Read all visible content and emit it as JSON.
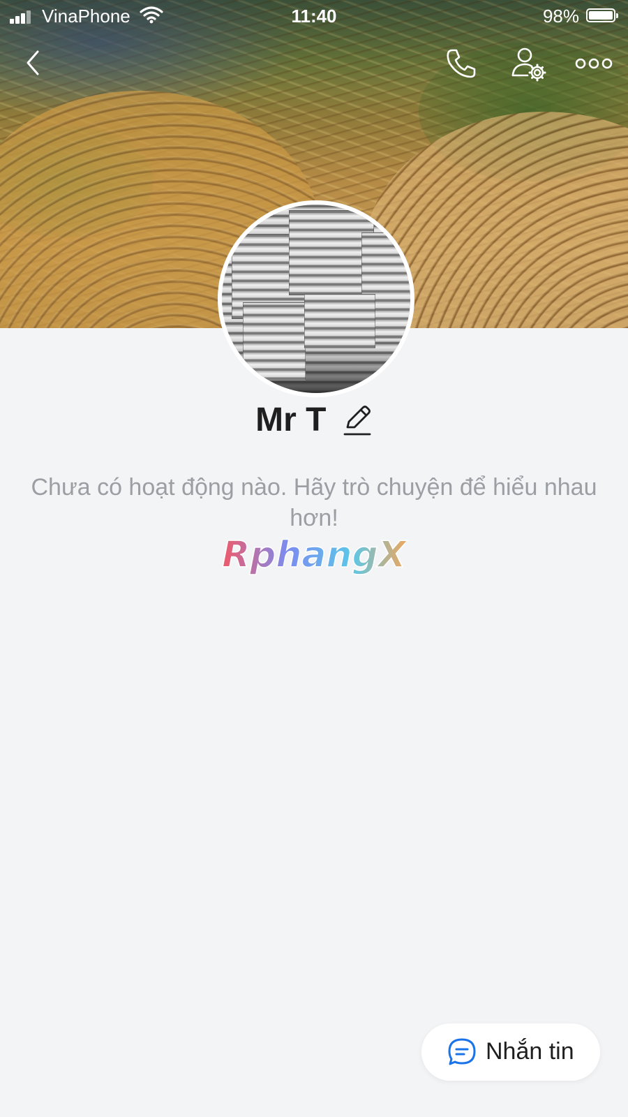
{
  "status_bar": {
    "carrier": "VinaPhone",
    "time": "11:40",
    "battery_percent": "98%"
  },
  "icons": {
    "back": "chevron-left-icon",
    "call": "phone-icon",
    "profile_settings": "user-gear-icon",
    "more": "more-dots-icon",
    "edit": "pencil-icon",
    "message": "chat-bubble-icon"
  },
  "profile": {
    "name": "Mr T",
    "empty_message": "Chưa có hoạt động nào. Hãy trò chuyện để hiểu nhau hơn!"
  },
  "watermark": "RphangX",
  "actions": {
    "message_label": "Nhắn tin"
  },
  "colors": {
    "background": "#f3f4f6",
    "text_primary": "#1f1f1f",
    "text_muted": "#9b9ea3",
    "accent_blue": "#1a73e8"
  }
}
